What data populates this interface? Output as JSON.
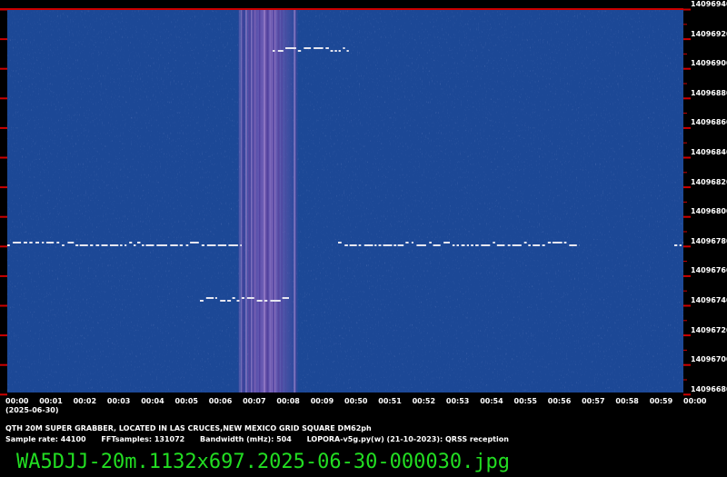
{
  "freq_labels": [
    "14096940",
    "14096920",
    "14096900",
    "14096880",
    "14096860",
    "14096840",
    "14096820",
    "14096800",
    "14096780",
    "14096760",
    "14096740",
    "14096720",
    "14096700",
    "14096680"
  ],
  "time_labels": [
    "00:00",
    "00:01",
    "00:02",
    "00:03",
    "00:04",
    "00:05",
    "00:06",
    "00:07",
    "00:08",
    "00:09",
    "00:50",
    "00:51",
    "00:52",
    "00:53",
    "00:54",
    "00:55",
    "00:56",
    "00:57",
    "00:58",
    "00:59",
    "00:00"
  ],
  "date": "(2025-06-30)",
  "info": {
    "qth": "QTH 20M SUPER GRABBER, LOCATED IN LAS CRUCES,NEW MEXICO GRID SQUARE DM62ph",
    "sample_rate": "Sample rate: 44100",
    "fft_samples": "FFTsamples: 131072",
    "bandwidth": "Bandwidth (mHz): 504",
    "software": "LOPORA-v5g.py(w) (21-10-2023): QRSS reception"
  },
  "filename": "WA5DJJ-20m.1132x697.2025-06-30-000030.jpg",
  "colors": {
    "background": "#1c4896",
    "top_line": "#cc0000",
    "tick": "#cc0000",
    "signal": "#e6e6f0",
    "filename": "#22dd22"
  }
}
